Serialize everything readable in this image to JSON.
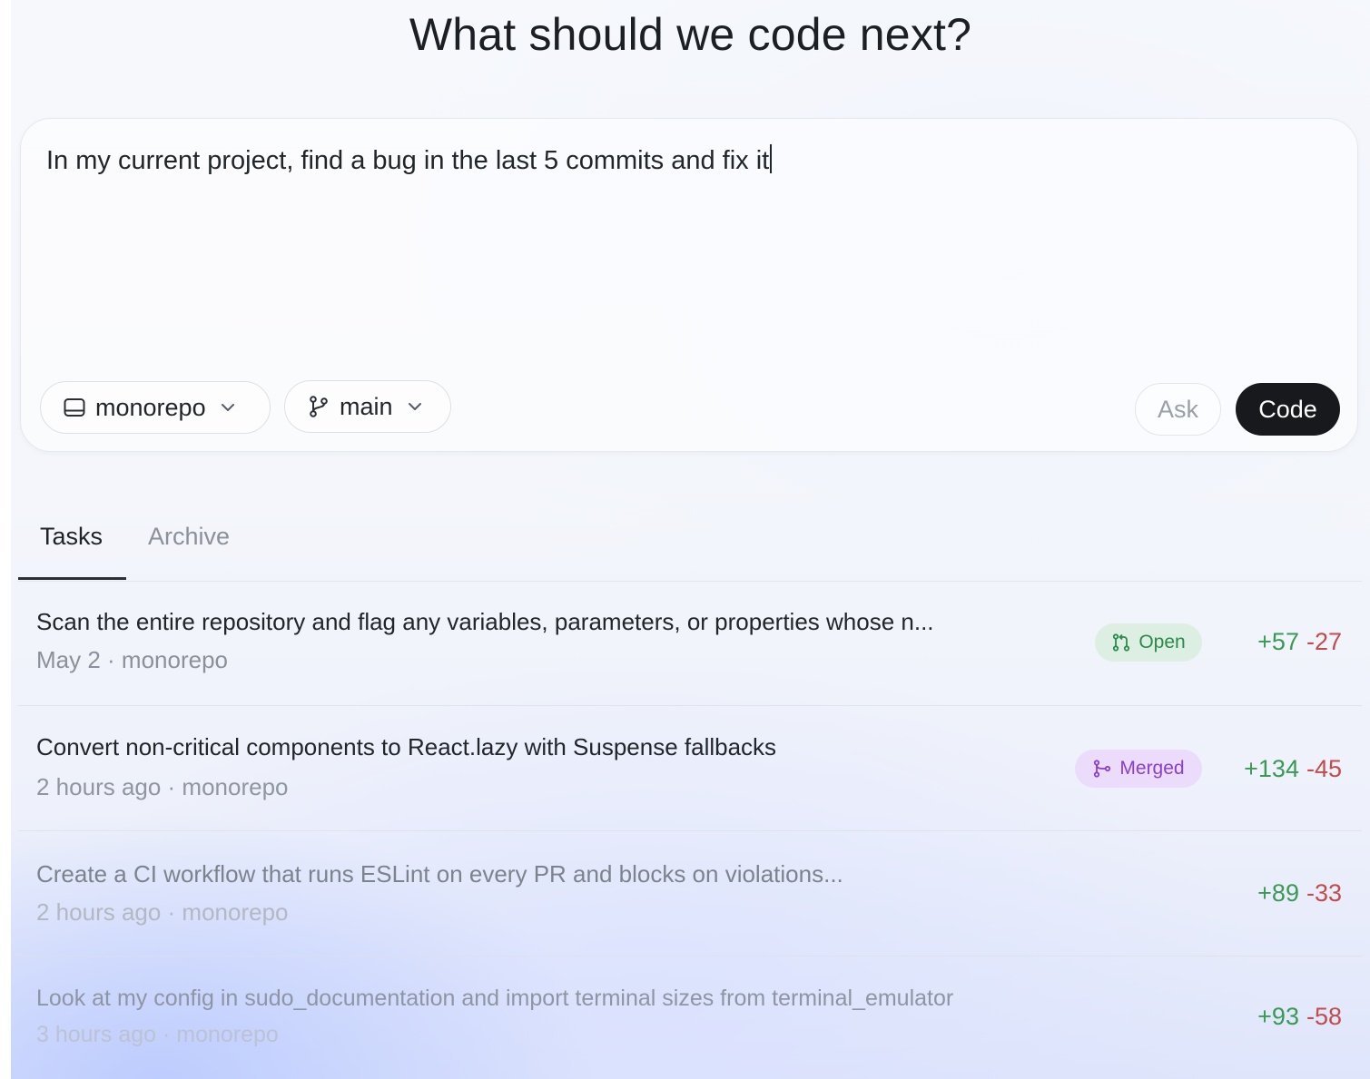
{
  "heading": "What should we code next?",
  "composer": {
    "prompt_text": "In my current project, find a bug in the last 5 commits and fix it",
    "repo_selector": {
      "label": "monorepo",
      "icon": "repo-icon"
    },
    "branch_selector": {
      "label": "main",
      "icon": "git-branch-icon"
    },
    "ask_label": "Ask",
    "code_label": "Code"
  },
  "tabs": [
    {
      "label": "Tasks",
      "active": true
    },
    {
      "label": "Archive",
      "active": false
    }
  ],
  "tasks": [
    {
      "title": "Scan the entire repository and flag any variables, parameters, or properties whose n...",
      "meta": "May 2 · monorepo",
      "status": "Open",
      "status_icon": "pull-request-icon",
      "additions": "+57",
      "deletions": "-27"
    },
    {
      "title": "Convert non-critical components to React.lazy with Suspense fallbacks",
      "meta": "2 hours ago · monorepo",
      "status": "Merged",
      "status_icon": "merge-icon",
      "additions": "+134",
      "deletions": "-45"
    },
    {
      "title": "Create a CI workflow that runs ESLint on every PR and blocks on violations...",
      "meta": "2 hours ago · monorepo",
      "status": "",
      "additions": "+89",
      "deletions": "-33"
    },
    {
      "title": "Look at my config in sudo_documentation and import terminal sizes from terminal_emulator",
      "meta": "3 hours ago · monorepo",
      "status": "",
      "additions": "+93",
      "deletions": "-58"
    }
  ],
  "colors": {
    "code_button_bg": "#17191c",
    "open_badge_bg": "#dcefe2",
    "open_badge_text": "#2b8a4a",
    "merged_badge_bg": "#ebdcfb",
    "merged_badge_text": "#8a3fd1",
    "additions": "#3a9a55",
    "deletions": "#c44b4b"
  }
}
